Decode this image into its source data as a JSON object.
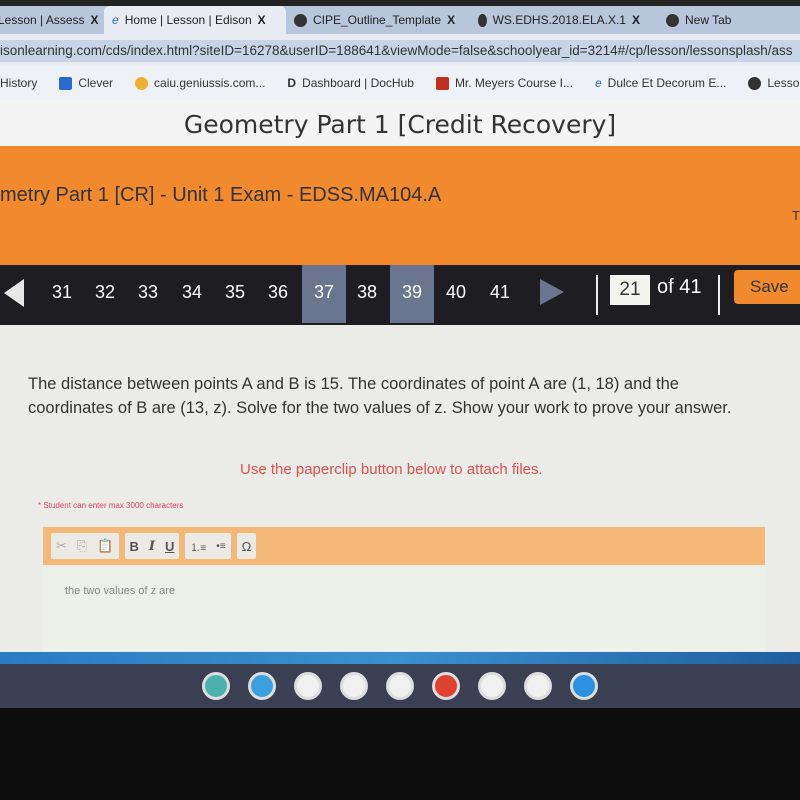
{
  "browser": {
    "tabs": [
      {
        "title": "Lesson | Assess",
        "icon": "edison-icon",
        "active": false
      },
      {
        "title": "Home | Lesson | Edison",
        "icon": "edge-e-icon",
        "active": true
      },
      {
        "title": "CIPE_Outline_Template",
        "icon": "globe-icon",
        "active": false
      },
      {
        "title": "WS.EDHS.2018.ELA.X.1",
        "icon": "globe-icon",
        "active": false
      },
      {
        "title": "New Tab",
        "icon": "chrome-icon",
        "active": false
      }
    ],
    "close_glyph": "X",
    "url": "isonlearning.com/cds/index.html?siteID=16278&userID=188641&viewMode=false&schoolyear_id=3214#/cp/lesson/lessonsplash/ass",
    "bookmarks": [
      {
        "label": "History",
        "icon": ""
      },
      {
        "label": "Clever",
        "icon": "clever-icon",
        "color": "#2a6ad0"
      },
      {
        "label": "caiu.geniussis.com...",
        "icon": "lightbulb-icon",
        "color": "#f0b030"
      },
      {
        "label": "Dashboard | DocHub",
        "icon": "dochub-icon",
        "color": "#222"
      },
      {
        "label": "Mr. Meyers Course I...",
        "icon": "flame-icon",
        "color": "#c03020"
      },
      {
        "label": "Dulce Et Decorum E...",
        "icon": "edge-e-icon",
        "color": "#2a6ad0"
      },
      {
        "label": "Lesson Video",
        "icon": "globe-icon",
        "color": "#333"
      }
    ]
  },
  "course_title": "Geometry Part 1 [Credit Recovery]",
  "exam_title": "metry Part 1 [CR] - Unit 1 Exam - EDSS.MA104.A",
  "header_right_partial": "T",
  "nav": {
    "numbers": [
      "31",
      "32",
      "33",
      "34",
      "35",
      "36",
      "37",
      "38",
      "39",
      "40",
      "41"
    ],
    "highlighted": [
      "37",
      "39"
    ],
    "current_page": "21",
    "of_total": "of 41",
    "save_label": "Save"
  },
  "question": {
    "text": "The distance between points A and B is 15. The coordinates of point A are (1, 18) and the coordinates of B are (13, z). Solve for the two values of z.  Show your work to prove your answer.",
    "attach_hint": "Use the paperclip button below to attach files.",
    "max_chars_note": "* Student can enter max 3000 characters"
  },
  "editor": {
    "tools": {
      "cut": "✂",
      "copy": "⎘",
      "paste": "📋",
      "bold": "B",
      "italic": "I",
      "underline": "U",
      "ordered_list": "⒈≡",
      "bullet_list": "•≡",
      "special_char": "Ω"
    },
    "content": "the two values of z are"
  },
  "shelf_apps": [
    {
      "name": "edison-app",
      "color": "#4ab0b0"
    },
    {
      "name": "meet-app",
      "color": "#3aa0e0"
    },
    {
      "name": "drive-app",
      "color": "#f0f0f0"
    },
    {
      "name": "jamboard-app",
      "color": "#f0f0f0"
    },
    {
      "name": "classroom-app",
      "color": "#f0f0f0"
    },
    {
      "name": "chrome-app",
      "color": "#e04030"
    },
    {
      "name": "play-store-app",
      "color": "#f0f0f0"
    },
    {
      "name": "docs-app",
      "color": "#f0f0f0"
    },
    {
      "name": "files-app",
      "color": "#2a90e0"
    }
  ]
}
